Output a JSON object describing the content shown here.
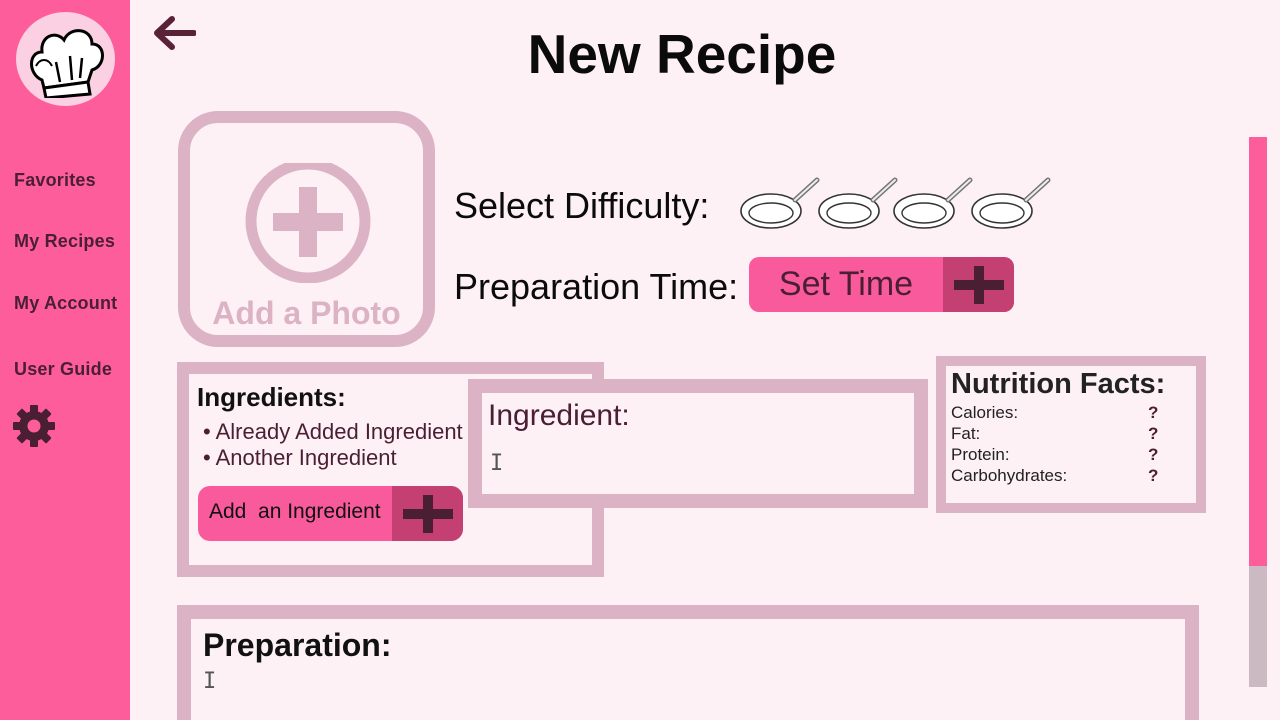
{
  "sidebar": {
    "items": [
      {
        "label": "Favorites"
      },
      {
        "label": "My Recipes"
      },
      {
        "label": "My Account"
      },
      {
        "label": "User Guide"
      }
    ]
  },
  "header": {
    "title": "New Recipe"
  },
  "photo": {
    "label": "Add a Photo"
  },
  "difficulty": {
    "label": "Select Difficulty:",
    "max": 4,
    "selected": 0
  },
  "prep_time": {
    "label": "Preparation Time:",
    "button_label": "Set Time"
  },
  "ingredients": {
    "title": "Ingredients:",
    "items": [
      "• Already Added Ingredient",
      "• Another Ingredient"
    ],
    "add_label": "Add  an Ingredient"
  },
  "ingredient_popup": {
    "label": "Ingredient:"
  },
  "nutrition": {
    "title": "Nutrition Facts:",
    "rows": [
      {
        "label": "Calories:",
        "value": "?"
      },
      {
        "label": "Fat:",
        "value": "?"
      },
      {
        "label": "Protein:",
        "value": "?"
      },
      {
        "label": "Carbohydrates:",
        "value": "?"
      }
    ]
  },
  "preparation": {
    "title": "Preparation:"
  },
  "scroll": {
    "position": 0.0,
    "visible_fraction": 0.78
  },
  "colors": {
    "sidebar": "#fd5d9b",
    "accent": "#f85a9b",
    "accent_dark": "#c43f72",
    "box_border": "#dbb3c4",
    "background": "#fdf1f5"
  },
  "icons": [
    "chef-hat-icon",
    "back-arrow-icon",
    "gear-icon",
    "add-photo-icon",
    "frying-pan-icon",
    "plus-icon",
    "text-cursor-icon"
  ]
}
